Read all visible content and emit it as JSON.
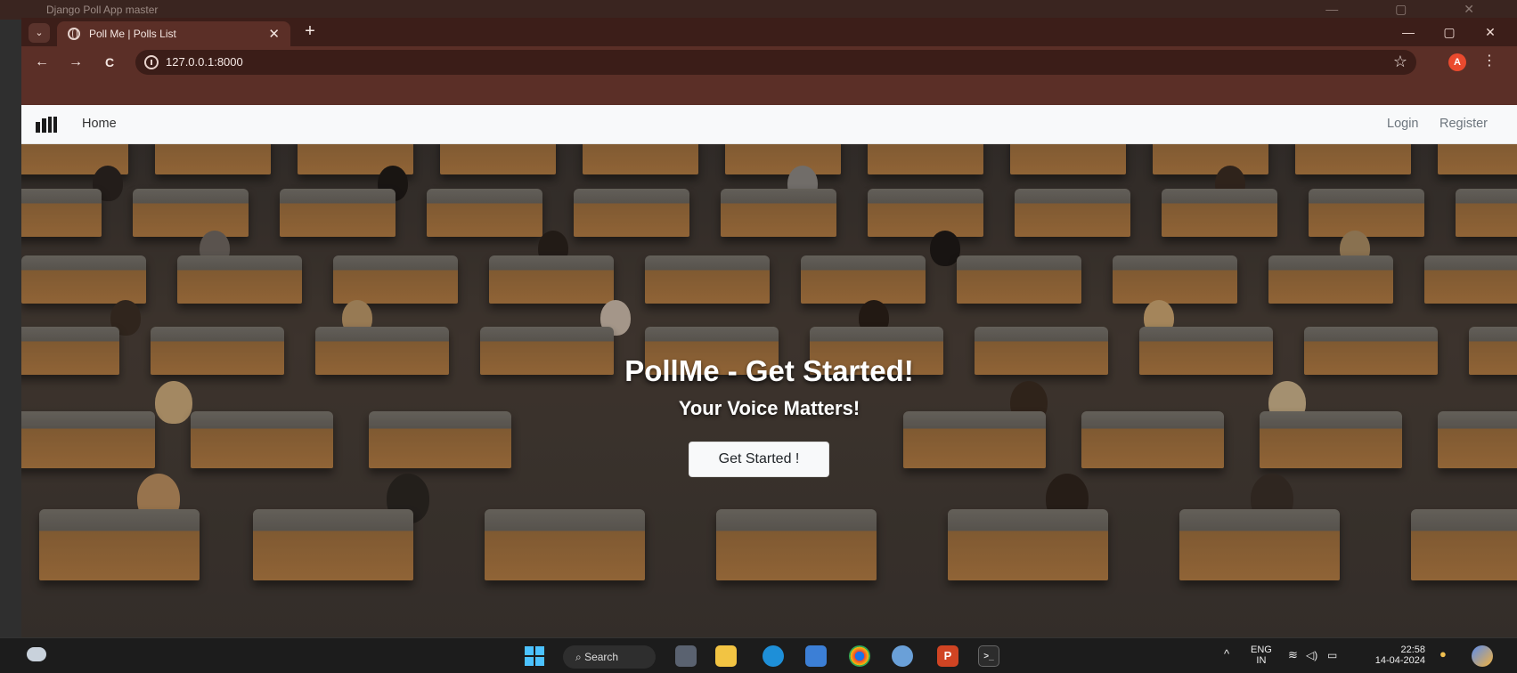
{
  "background_window": {
    "title": "Django Poll App master",
    "controls": [
      "—",
      "▢",
      "✕"
    ]
  },
  "browser": {
    "tab_title": "Poll Me | Polls List",
    "tab_close": "✕",
    "new_tab": "+",
    "tab_search": "⌄",
    "window_controls": {
      "minimize": "—",
      "maximize": "▢",
      "close": "✕"
    },
    "nav": {
      "back": "←",
      "forward": "→",
      "reload": "C"
    },
    "url": "127.0.0.1:8000",
    "star": "☆",
    "profile_initial": "A",
    "menu": "⋮"
  },
  "navbar": {
    "home": "Home",
    "login": "Login",
    "register": "Register"
  },
  "hero": {
    "title": "PollMe - Get Started!",
    "subtitle": "Your Voice Matters!",
    "cta": "Get Started !"
  },
  "taskbar": {
    "search_label": "Search",
    "lang_top": "ENG",
    "lang_bottom": "IN",
    "time": "22:58",
    "date": "14-04-2024",
    "tray_expand": "^"
  }
}
